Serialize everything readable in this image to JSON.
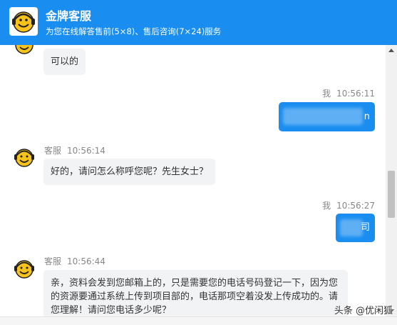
{
  "header": {
    "title": "金牌客服",
    "subtitle": "为您在线解答售前(5×8)、售后咨询(7×24)服务"
  },
  "messages": [
    {
      "sender": "",
      "time": "",
      "text": "可以的"
    },
    {
      "sender": "我",
      "time": "10:56:11",
      "text": "n"
    },
    {
      "sender": "客服",
      "time": "10:56:14",
      "text": "好的，请问怎么称呼您呢？先生女士？"
    },
    {
      "sender": "我",
      "time": "10:56:27",
      "text": "司"
    },
    {
      "sender": "客服",
      "time": "10:56:44",
      "text": "亲，资料会发到您邮箱上的，只是需要您的电话号码登记一下，因为您的资源要通过系统上传到项目部的，电话那项空着没发上传成功的。请您理解！请问您电话多少呢？"
    }
  ],
  "watermark": "头条 @优闲狐",
  "colors": {
    "header": "#1a8ef0",
    "agent_bubble": "#f1f3f5",
    "user_bubble": "#1a8ef0"
  }
}
